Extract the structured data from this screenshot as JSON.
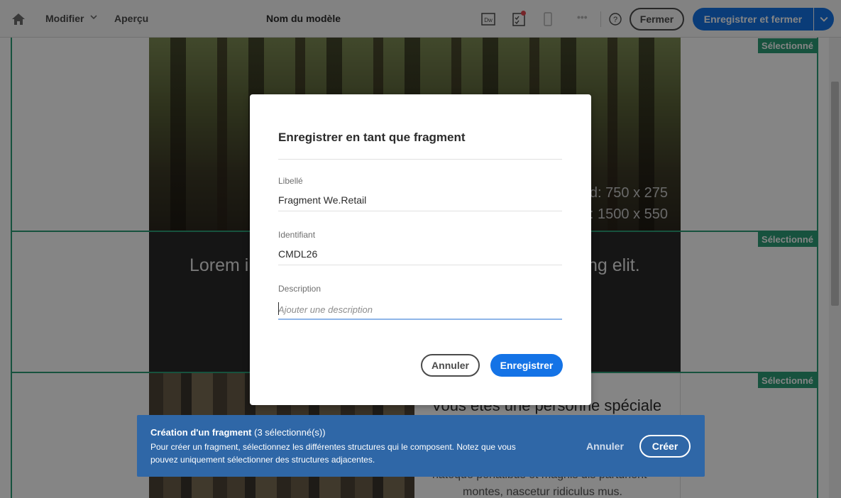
{
  "topbar": {
    "modify_label": "Modifier",
    "preview_label": "Aperçu",
    "template_name": "Nom du modèle",
    "close_label": "Fermer",
    "save_close_label": "Enregistrer et fermer",
    "dw_label": "Dw",
    "more_label": "•••",
    "help_label": "?",
    "icons": [
      "home-icon",
      "chevron-down-icon",
      "dreamweaver-icon",
      "checklist-icon",
      "mobile-icon",
      "more-icon",
      "help-icon"
    ]
  },
  "canvas": {
    "selected_label": "Sélectionné",
    "hero_text_1": "d: 750 x 275",
    "hero_text_2": "a: 1500 x 550",
    "lorem_left": "Lorem i",
    "lorem_right": "ng elit.",
    "headline": "Vous êtes une personne spéciale",
    "body_line_1": "natoque penatibus et magnis dis parturient",
    "body_line_2": "montes, nascetur ridiculus mus."
  },
  "modal": {
    "title": "Enregistrer en tant que fragment",
    "label_field": {
      "label": "Libellé",
      "value": "Fragment We.Retail"
    },
    "id_field": {
      "label": "Identifiant",
      "value": "CMDL26"
    },
    "description_field": {
      "label": "Description",
      "placeholder": "Ajouter une description",
      "value": ""
    },
    "cancel_label": "Annuler",
    "save_label": "Enregistrer"
  },
  "toast": {
    "title": "Création d'un fragment",
    "count": "(3 sélectionné(s))",
    "body": "Pour créer un fragment, sélectionnez les différentes structures qui le composent. Notez que vous pouvez uniquement sélectionner des structures adjacentes.",
    "cancel_label": "Annuler",
    "create_label": "Créer"
  },
  "colors": {
    "primary_blue": "#1473e6",
    "selection_green": "#2d9d78",
    "toast_blue": "#2f67a7",
    "notification_red": "#e34850"
  }
}
